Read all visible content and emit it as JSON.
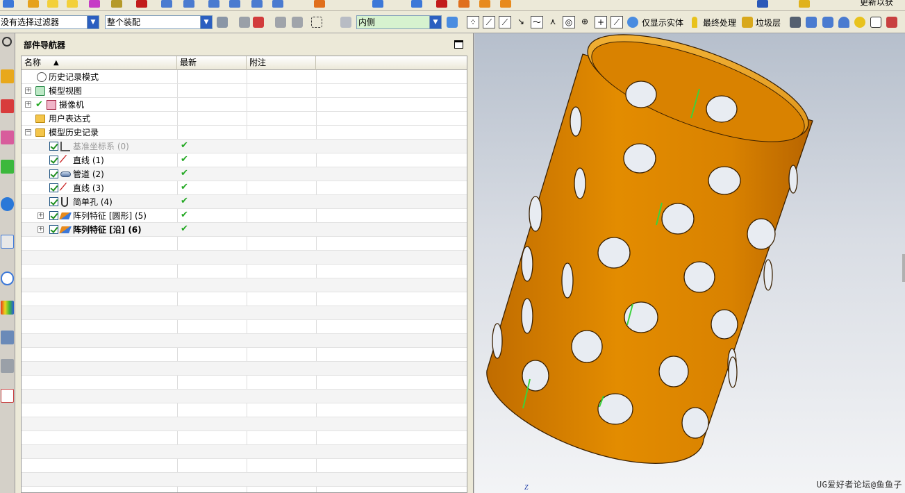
{
  "top_toolbar": {
    "partial_label": "更新以获",
    "icons": [
      "view-icon",
      "save-icon",
      "undo-icon",
      "redo-icon",
      "palette-icon",
      "layer-icon",
      "render-icon",
      "section-icon",
      "sketch-icon",
      "point-icon",
      "blend-icon",
      "hole-icon",
      "pattern-icon",
      "fillet-icon",
      "shell-icon",
      "extrude-icon",
      "revolve-icon",
      "datum-icon",
      "block-icon",
      "cylinder-icon",
      "cone-icon",
      "sphere-icon"
    ]
  },
  "selection_bar": {
    "filter_value": "没有选择过滤器",
    "scope_value": "整个装配",
    "face_rule_value": "内侧",
    "solid_only_label": "仅显示实体",
    "final_process_label": "最终处理",
    "trash_layer_label": "垃圾层"
  },
  "navigator": {
    "title": "部件导航器",
    "columns": [
      "名称",
      "最新",
      "附注"
    ],
    "rows": [
      {
        "label": "历史记录模式",
        "icon": "clock-icon"
      },
      {
        "label": "模型视图",
        "icon": "model-views-icon"
      },
      {
        "label": "摄像机",
        "icon": "camera-icon"
      },
      {
        "label": "用户表达式",
        "icon": "expression-folder-icon"
      },
      {
        "label": "模型历史记录",
        "icon": "history-folder-icon"
      },
      {
        "label": "基准坐标系 (0)",
        "icon": "datum-csys-icon",
        "latest": "✔"
      },
      {
        "label": "直线 (1)",
        "icon": "line-icon",
        "latest": "✔"
      },
      {
        "label": "管道 (2)",
        "icon": "tube-icon",
        "latest": "✔"
      },
      {
        "label": "直线 (3)",
        "icon": "line-icon",
        "latest": "✔"
      },
      {
        "label": "简单孔 (4)",
        "icon": "hole-icon",
        "latest": "✔"
      },
      {
        "label": "阵列特征 [圆形] (5)",
        "icon": "pattern-icon",
        "latest": "✔"
      },
      {
        "label": "阵列特征 [沿] (6)",
        "icon": "pattern-icon",
        "latest": "✔"
      }
    ]
  },
  "viewport": {
    "axis_label": "Z",
    "watermark": "UG爱好者论坛@鱼鱼子",
    "colors": {
      "body": "#d98200",
      "inner": "#f2a81e",
      "edge": "#3a2000",
      "axis": "#3cd23c"
    }
  }
}
